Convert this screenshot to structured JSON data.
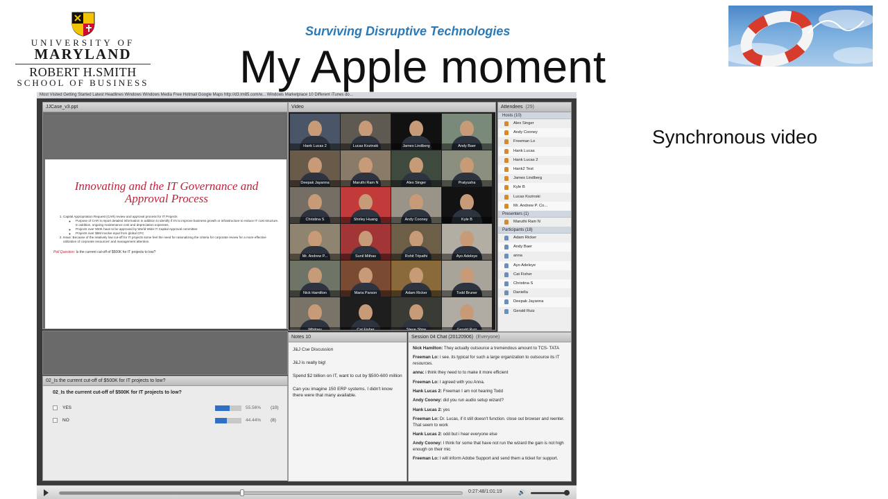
{
  "logo": {
    "uni_of": "UNIVERSITY OF",
    "uni_name": "MARYLAND",
    "school_name": "ROBERT H.SMITH",
    "school_sub": "SCHOOL OF BUSINESS"
  },
  "slide": {
    "subtitle": "Surviving Disruptive Technologies",
    "title": "My Apple moment",
    "side_label": "Synchronous video"
  },
  "browser_bar": "Most Visited   Getting Started   Latest Headlines   Windows   Windows Media   Free Hotmail   Google Maps   http://d3.lm85.com/w...   Windows Marketplace   10 Different iTunes do...",
  "share_pod": {
    "title": "JJCase_v3.ppt",
    "page_title": "Innovating and the IT Governance and Approval Process",
    "items": [
      "Capital Appropriation Request (CAR) review and approval process for IT Projects",
      "Issue:  Because of the relatively low cut-off for IT projects some feel  the need for rationalizing the criteria for corporate review for a more effective utilization of corporate resources' and management attention."
    ],
    "subitems": [
      "Purpose of CAR is report detailed information in addition to identify if it's to improve business growth or infrastructure to reduce IT cost structure.  In addition, ongoing maintenance cost and depreciation expenses.",
      "Projects over 500K have to be approved by World Wide IT Capital Approval committee",
      "Projects over $5M involve input from global CFC"
    ],
    "poll_label": "Poll Question:",
    "poll_text": " Is the current cut-off of $500K for IT projects to low?"
  },
  "poll_pod": {
    "title": "02_Is the current cut-off of $500K for IT projects to low?",
    "question": "02_Is the current cut-off of $500K for IT projects to low?",
    "options": [
      {
        "label": "YES",
        "fraction": 0.5556,
        "pct": "55.56%",
        "count": "(10)"
      },
      {
        "label": "NO",
        "fraction": 0.4444,
        "pct": "44.44%",
        "count": "(8)"
      }
    ]
  },
  "video_pod": {
    "title": "Video",
    "tiles": [
      {
        "name": "Hank Lucas 2",
        "bg": "#4a5668"
      },
      {
        "name": "Lucas Kozinski",
        "bg": "#5e5a52"
      },
      {
        "name": "James Lindberg",
        "bg": "#111111"
      },
      {
        "name": "Andy Baer",
        "bg": "#7a8a7a"
      },
      {
        "name": "Deepak Jayanna",
        "bg": "#6a5a4a"
      },
      {
        "name": "Maruthi Ram N",
        "bg": "#8a7a68"
      },
      {
        "name": "Alex Singer",
        "bg": "#3f4a3e"
      },
      {
        "name": "Pratyusha",
        "bg": "#8b8f7e"
      },
      {
        "name": "Christina S",
        "bg": "#746e64"
      },
      {
        "name": "Shirley Huang",
        "bg": "#c23a3a"
      },
      {
        "name": "Andy Cooney",
        "bg": "#9a9488"
      },
      {
        "name": "Kyle B",
        "bg": "#121212"
      },
      {
        "name": "Mr. Andrew P...",
        "bg": "#8e8470"
      },
      {
        "name": "Sunil Mithas",
        "bg": "#a23636"
      },
      {
        "name": "Rohit Tripathi",
        "bg": "#6d5e48"
      },
      {
        "name": "Ayo Adeleye",
        "bg": "#b2aea4"
      },
      {
        "name": "Nick Hamilton",
        "bg": "#6e7466"
      },
      {
        "name": "Maria Parson",
        "bg": "#7a4a32"
      },
      {
        "name": "Adam Ricker",
        "bg": "#8a6a3a"
      },
      {
        "name": "Todd Bruner",
        "bg": "#a8a49a"
      },
      {
        "name": "Whitney",
        "bg": "#7a7468"
      },
      {
        "name": "Cat Fisher",
        "bg": "#1e1e1e"
      },
      {
        "name": "Steve Shire",
        "bg": "#3b3b36"
      },
      {
        "name": "Gerald Ruiz",
        "bg": "#b0aca4"
      }
    ]
  },
  "attendees_pod": {
    "title": "Attendees",
    "count": "(29)",
    "hosts_label": "Hosts (10)",
    "hosts": [
      "Alex Singer",
      "Andy Cooney",
      "Freeman Lo",
      "Hank Lucas",
      "Hank Lucas 2",
      "Hank2 Test",
      "James Lindberg",
      "Kyle B",
      "Lucas Kozinski",
      "Mr. Andrew P. Co..."
    ],
    "presenters_label": "Presenters (1)",
    "presenters": [
      "Maruthi Ram N"
    ],
    "participants_label": "Participants (18)",
    "participants": [
      "Adam Ricker",
      "Andy Baer",
      "anna",
      "Ayo Adeleye",
      "Cat Fisher",
      "Christina S",
      "Daniella",
      "Deepak Jayanna",
      "Gerald Ruiz"
    ]
  },
  "notes_pod": {
    "title": "Notes 10",
    "lines": [
      "J&J Cse Discussion",
      "J&J is really big!",
      "Spend $2 billion on IT, want to cut by $500-600 million",
      "Can you imagine 150 ERP systems.  I didn't know there were that many available."
    ]
  },
  "chat_pod": {
    "title": "Session 04 Chat (20120906)",
    "scope": "(Everyone)",
    "messages": [
      {
        "who": "Nick Hamilton:",
        "text": " They actually outsource a tremendous amount to TCS- TATA"
      },
      {
        "who": "Freeman Lo:",
        "text": " i see. its typical for such a large organization to outsource its IT resources."
      },
      {
        "who": "anna:",
        "text": " i think they need to to make it more efficient"
      },
      {
        "who": "Freeman Lo:",
        "text": " I agreed with you Anna."
      },
      {
        "who": "Hank Lucas 2:",
        "text": " Freeman I am not hearing Todd"
      },
      {
        "who": "Andy Cooney:",
        "text": " did you run audio setup wizard?"
      },
      {
        "who": "Hank Lucas 2:",
        "text": " yes"
      },
      {
        "who": "Freeman Lo:",
        "text": " Dr. Lucas, if it still doesn't function. close out browser and reenter. That seem to work"
      },
      {
        "who": "Hank Lucas 2:",
        "text": " odd but i hear everyone else"
      },
      {
        "who": "Andy Cooney:",
        "text": " I think for some that have not run the wizard the gain is not high enough on their mic"
      },
      {
        "who": "Freeman Lo:",
        "text": " I will inform Adobe Support and send them a ticket for support."
      }
    ]
  },
  "player": {
    "time": "0:27:48/1:01:19",
    "progress": 0.453,
    "volume": 0.9
  }
}
